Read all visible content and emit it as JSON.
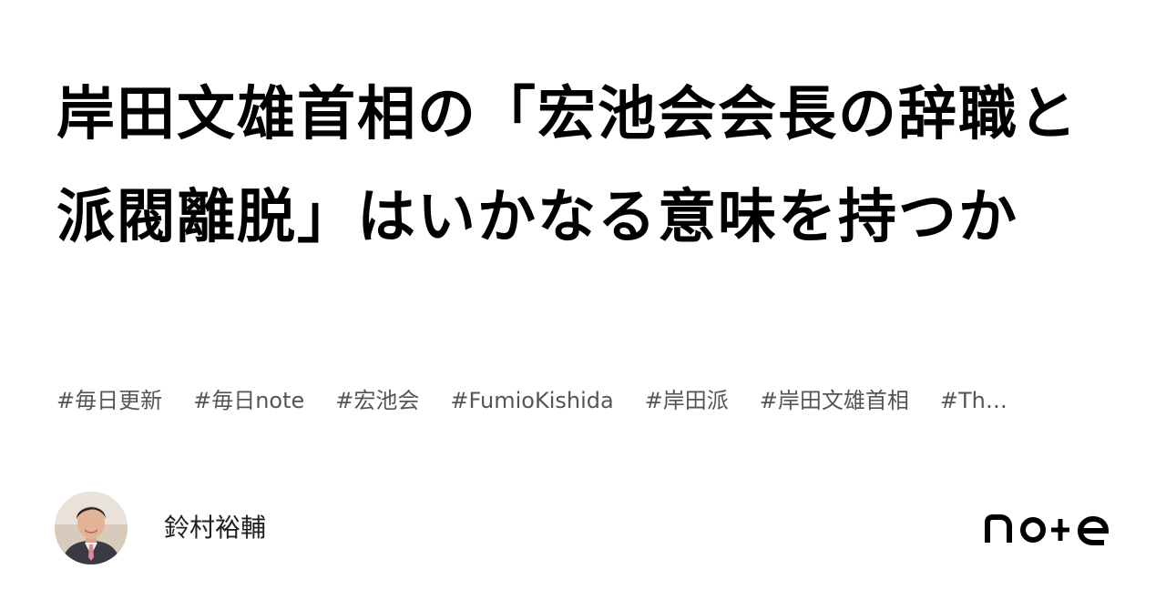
{
  "title": "岸田文雄首相の「宏池会会長の辞職と派閥離脱」はいかなる意味を持つか",
  "tags": [
    "#毎日更新",
    "#毎日note",
    "#宏池会",
    "#FumioKishida",
    "#岸田派",
    "#岸田文雄首相",
    "#Th…"
  ],
  "author": {
    "name": "鈴村裕輔"
  },
  "brand": {
    "name": "note"
  }
}
